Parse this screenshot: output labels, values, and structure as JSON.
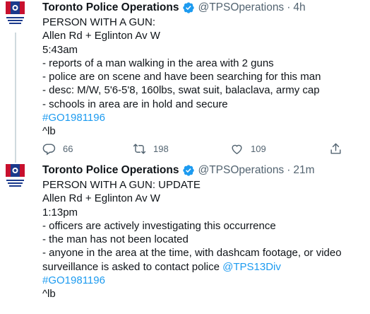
{
  "colors": {
    "link": "#1d9bf0",
    "muted": "#536471",
    "text": "#0f1419",
    "verified": "#1d9bf0"
  },
  "tweets": [
    {
      "avatar_icon": "toronto-police-logo-icon",
      "name": "Toronto Police Operations",
      "handle": "@TPSOperations",
      "sep": "·",
      "time": "4h",
      "lines": [
        "PERSON WITH A GUN:",
        "Allen Rd + Eglinton Av W",
        "5:43am",
        "- reports of a man walking in the area with 2 guns",
        "- police are on scene and have been searching for this man",
        "- desc: M/W, 5'6-5'8, 160lbs, swat suit, balaclava, army cap",
        "- schools in area are in hold and secure"
      ],
      "hashtag": "#GO1981196",
      "signature": "^lb",
      "replies": "66",
      "retweets": "198",
      "likes": "109"
    },
    {
      "avatar_icon": "toronto-police-logo-icon",
      "name": "Toronto Police Operations",
      "handle": "@TPSOperations",
      "sep": "·",
      "time": "21m",
      "lines": [
        "PERSON WITH A GUN: UPDATE",
        "Allen Rd + Eglinton Av W",
        "1:13pm",
        "- officers are actively investigating this occurrence",
        "- the man has not been located",
        "- anyone in the area at the time, with dashcam footage, or video"
      ],
      "line7_text": "surveillance is asked to contact police ",
      "mention": "@TPS13Div",
      "hashtag": "#GO1981196",
      "signature": "^lb"
    }
  ]
}
